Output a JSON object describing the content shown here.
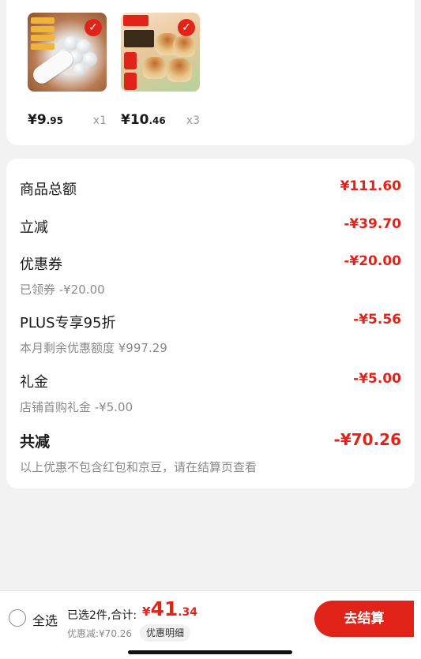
{
  "products": [
    {
      "price_int": "¥9",
      "price_dec": ".95",
      "qty": "x1"
    },
    {
      "price_int": "¥10",
      "price_dec": ".46",
      "qty": "x3"
    }
  ],
  "summary": {
    "goods_total": {
      "label": "商品总额",
      "value": "¥111.60"
    },
    "instant_off": {
      "label": "立减",
      "value": "-¥39.70"
    },
    "coupon": {
      "label": "优惠券",
      "value": "-¥20.00",
      "sub": "已领券 -¥20.00"
    },
    "plus": {
      "label": "PLUS专享95折",
      "value": "-¥5.56",
      "sub": "本月剩余优惠额度 ¥997.29"
    },
    "gift": {
      "label": "礼金",
      "value": "-¥5.00",
      "sub": "店铺首购礼金 -¥5.00"
    },
    "total_off": {
      "label": "共减",
      "value": "-¥70.26",
      "sub": "以上优惠不包含红包和京豆，请在结算页查看"
    }
  },
  "bottom": {
    "select_all": "全选",
    "selected_text": "已选2件,合计:",
    "total_yen": "¥",
    "total_int": "41",
    "total_dec": ".34",
    "discount_text": "优惠减:¥70.26",
    "detail_btn": "优惠明细",
    "checkout_btn": "去结算"
  },
  "icons": {
    "check": "check-icon",
    "radio": "radio-unchecked-icon"
  },
  "colors": {
    "accent": "#e2231a"
  }
}
